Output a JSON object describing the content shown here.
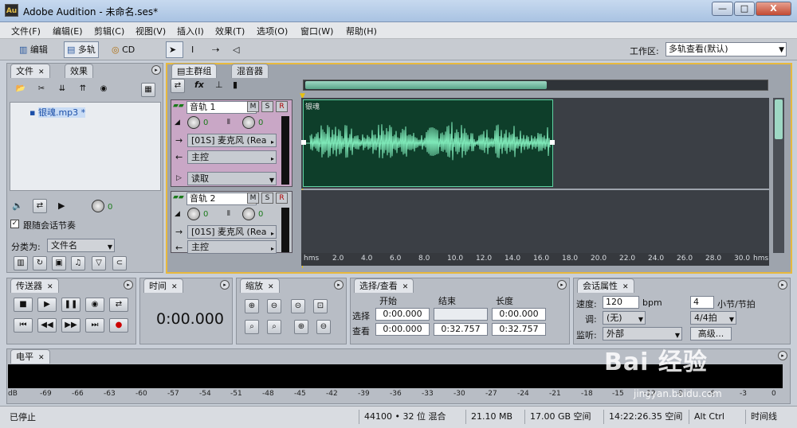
{
  "window": {
    "app_icon": "Au",
    "title": "Adobe Audition - 未命名.ses*",
    "minimize": "—",
    "maximize": "□",
    "close": "X"
  },
  "menu": [
    "文件(F)",
    "编辑(E)",
    "剪辑(C)",
    "视图(V)",
    "插入(I)",
    "效果(T)",
    "选项(O)",
    "窗口(W)",
    "帮助(H)"
  ],
  "toolbar": {
    "edit": "编辑",
    "multitrack": "多轨",
    "cd": "CD",
    "workspace_label": "工作区:",
    "workspace_value": "多轨查看(默认)"
  },
  "files_panel": {
    "tab_files": "文件",
    "tab_effects": "效果",
    "file_item": "银魂.mp3 *",
    "follow_session": "跟随会话节奏",
    "sort_label": "分类为:",
    "sort_value": "文件名",
    "volume_value": "0"
  },
  "main_panel": {
    "tab_main": "主群组",
    "tab_mixer": "混音器"
  },
  "tracks": [
    {
      "name": "音轨 1",
      "volume": "0",
      "pan": "0",
      "input": "[01S] 麦克风 (Rea",
      "output": "主控",
      "mode": "读取"
    },
    {
      "name": "音轨 2",
      "volume": "0",
      "pan": "0",
      "input": "[01S] 麦克风 (Rea",
      "output": "主控"
    }
  ],
  "clip": {
    "name": "银魂",
    "color": "#0e3e2a",
    "wave_color": "#7ee8b8"
  },
  "ruler": [
    "hms",
    "2.0",
    "4.0",
    "6.0",
    "8.0",
    "10.0",
    "12.0",
    "14.0",
    "16.0",
    "18.0",
    "20.0",
    "22.0",
    "24.0",
    "26.0",
    "28.0",
    "30.0",
    "hms"
  ],
  "transport": {
    "tab": "传送器"
  },
  "time_panel": {
    "tab": "时间",
    "value": "0:00.000"
  },
  "zoom_panel": {
    "tab": "缩放"
  },
  "selection_panel": {
    "tab": "选择/查看",
    "col_start": "开始",
    "col_end": "结束",
    "col_length": "长度",
    "row_select": "选择",
    "row_view": "查看",
    "select_start": "0:00.000",
    "select_end": "",
    "select_length": "0:00.000",
    "view_start": "0:00.000",
    "view_end": "0:32.757",
    "view_length": "0:32.757"
  },
  "session_panel": {
    "tab": "会话属性",
    "tempo_label": "速度:",
    "tempo_value": "120",
    "tempo_unit": "bpm",
    "beats_value": "4",
    "beats_unit": "小节/节拍",
    "key_label": "调:",
    "key_value": "(无)",
    "time_sig_value": "4/4拍",
    "monitor_label": "监听:",
    "monitor_value": "外部",
    "advanced": "高级..."
  },
  "level_panel": {
    "tab": "电平",
    "scale": [
      "dB",
      "-69",
      "-66",
      "-63",
      "-60",
      "-57",
      "-54",
      "-51",
      "-48",
      "-45",
      "-42",
      "-39",
      "-36",
      "-33",
      "-30",
      "-27",
      "-24",
      "-21",
      "-18",
      "-15",
      "-12",
      "-9",
      "-6",
      "-3",
      "0"
    ]
  },
  "status": {
    "state": "已停止",
    "format": "44100 • 32 位 混合",
    "memory": "21.10 MB",
    "disk": "17.00 GB 空间",
    "clock": "14:22:26.35 空间",
    "key": "Alt Ctrl",
    "mode": "时间线"
  },
  "watermark": {
    "brand": "Bai 经验",
    "url": "jingyan.baidu.com"
  }
}
